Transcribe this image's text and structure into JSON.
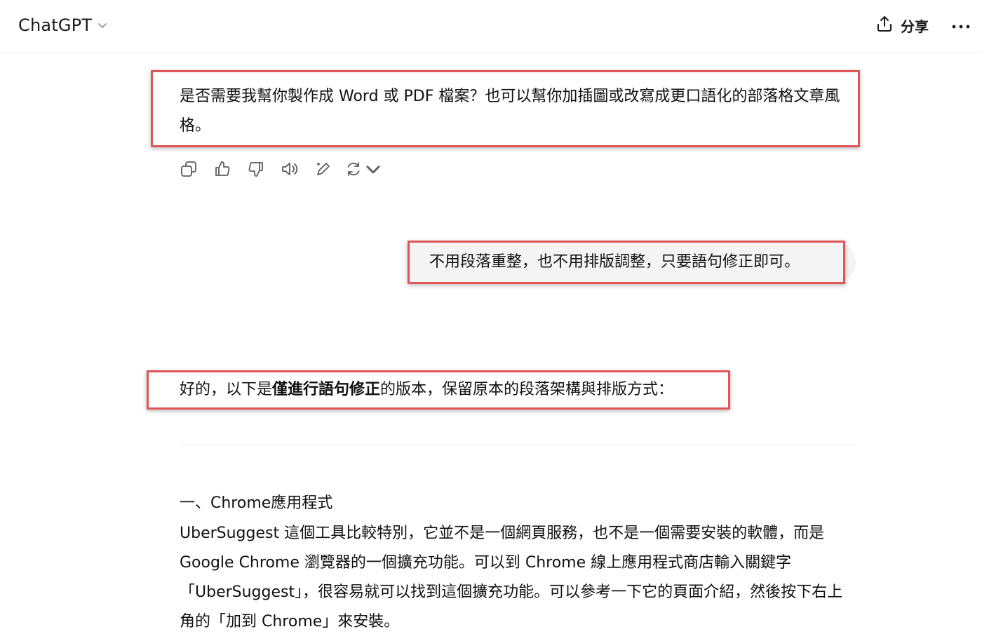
{
  "header": {
    "model_name": "ChatGPT",
    "share_label": "分享"
  },
  "messages": {
    "assistant_prev": "是否需要我幫你製作成 Word 或 PDF 檔案？也可以幫你加插圖或改寫成更口語化的部落格文章風格。",
    "user": "不用段落重整，也不用排版調整，只要語句修正即可。",
    "assistant_intro_before": "好的，以下是",
    "assistant_intro_bold": "僅進行語句修正",
    "assistant_intro_after": "的版本，保留原本的段落架構與排版方式：",
    "section_title": "一、Chrome應用程式",
    "section_body": "UberSuggest 這個工具比較特別，它並不是一個網頁服務，也不是一個需要安裝的軟體，而是 Google Chrome 瀏覽器的一個擴充功能。可以到 Chrome 線上應用程式商店輸入關鍵字「UberSuggest」，很容易就可以找到這個擴充功能。可以參考一下它的頁面介紹，然後按下右上角的「加到 Chrome」來安裝。"
  },
  "actions": [
    {
      "icon": "copy-icon"
    },
    {
      "icon": "thumbs-up-icon"
    },
    {
      "icon": "thumbs-down-icon"
    },
    {
      "icon": "read-aloud-icon"
    },
    {
      "icon": "edit-in-canvas-icon"
    },
    {
      "icon": "regenerate-icon"
    }
  ],
  "colors": {
    "highlight_border": "#e05557",
    "user_bubble": "#f4f4f4",
    "text": "#0d0d0d"
  }
}
